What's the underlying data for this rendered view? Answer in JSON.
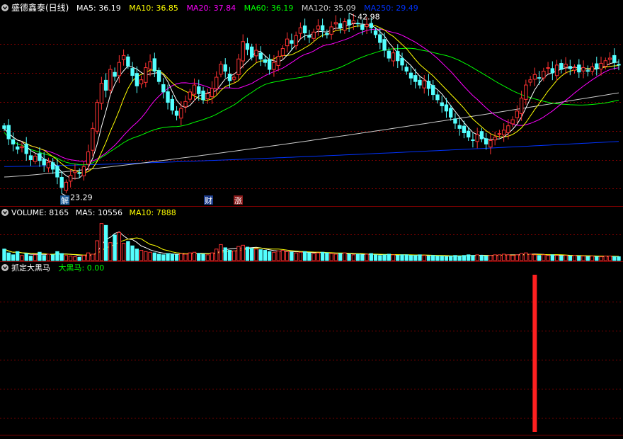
{
  "header": {
    "stock": "盛德鑫泰(日线)",
    "ma_items": [
      {
        "label": "MA5: 36.19",
        "color": "#ffffff"
      },
      {
        "label": "MA10: 36.85",
        "color": "#ffff00"
      },
      {
        "label": "MA20: 37.84",
        "color": "#ff00ff"
      },
      {
        "label": "MA60: 36.19",
        "color": "#00ff00"
      },
      {
        "label": "MA120: 35.09",
        "color": "#cccccc"
      },
      {
        "label": "MA250: 29.49",
        "color": "#0033ff"
      }
    ]
  },
  "volume_header": {
    "items": [
      {
        "label": "VOLUME: 8165",
        "color": "#ffffff"
      },
      {
        "label": "MA5: 10556",
        "color": "#ffffff"
      },
      {
        "label": "MA10: 7888",
        "color": "#ffff00"
      }
    ]
  },
  "indicator_header": {
    "name": "抓定大黑马",
    "value_label": "大黑马: 0.00",
    "value_color": "#00ff00"
  },
  "annotations": {
    "high": "42.98",
    "low": "23.29",
    "markers": [
      {
        "text": "解",
        "bg": "#1a5a9a"
      },
      {
        "text": "财",
        "bg": "#1a3a8a"
      },
      {
        "text": "涨",
        "bg": "#8a1a1a"
      }
    ]
  },
  "colors": {
    "up": "#ff3232",
    "down": "#54ffff",
    "grid": "#800000"
  },
  "chart_data": {
    "type": "candlestick",
    "price_range": [
      22.3,
      44.0
    ],
    "closes": [
      31.0,
      29.8,
      29.2,
      28.6,
      28.9,
      28.1,
      27.4,
      27.8,
      27.3,
      26.8,
      27.1,
      26.3,
      25.4,
      24.2,
      24.8,
      25.6,
      26.1,
      25.8,
      26.6,
      28.3,
      31.0,
      34.0,
      36.2,
      35.4,
      37.8,
      37.0,
      38.6,
      39.4,
      38.2,
      37.1,
      35.9,
      36.6,
      38.0,
      38.7,
      37.6,
      36.4,
      35.2,
      34.0,
      33.1,
      32.5,
      33.3,
      34.1,
      35.2,
      36.0,
      35.0,
      34.3,
      35.0,
      35.6,
      36.9,
      38.4,
      37.6,
      36.5,
      36.9,
      39.0,
      41.0,
      40.1,
      39.2,
      40.0,
      39.0,
      38.6,
      37.8,
      38.6,
      39.3,
      40.2,
      41.3,
      40.8,
      41.7,
      42.6,
      42.0,
      41.5,
      42.1,
      42.8,
      42.3,
      41.8,
      42.7,
      43.2,
      42.6,
      43.3,
      42.9,
      43.4,
      43.1,
      42.4,
      43.0,
      42.6,
      41.8,
      40.9,
      40.0,
      39.1,
      39.7,
      38.8,
      38.3,
      37.6,
      36.8,
      36.4,
      36.0,
      36.5,
      35.6,
      34.9,
      34.3,
      33.6,
      33.0,
      32.3,
      31.6,
      31.0,
      30.5,
      30.0,
      29.6,
      30.3,
      29.8,
      29.2,
      29.6,
      30.0,
      30.4,
      30.8,
      31.3,
      32.0,
      33.0,
      34.5,
      36.0,
      36.6,
      37.2,
      36.8,
      37.6,
      38.0,
      37.4,
      38.3,
      37.8,
      38.4,
      37.9,
      38.0,
      37.5,
      38.0,
      37.6,
      38.1,
      37.9,
      38.5,
      38.8,
      39.1,
      38.6,
      38.3
    ],
    "volumes": [
      18,
      12,
      9,
      14,
      8,
      11,
      7,
      9,
      13,
      8,
      10,
      9,
      14,
      11,
      8,
      7,
      6,
      5,
      8,
      12,
      10,
      31,
      58,
      55,
      28,
      40,
      44,
      27,
      30,
      23,
      18,
      16,
      14,
      13,
      12,
      10,
      9,
      11,
      10,
      9,
      11,
      10,
      12,
      13,
      11,
      10,
      9,
      12,
      18,
      25,
      20,
      16,
      15,
      22,
      24,
      21,
      19,
      18,
      17,
      16,
      14,
      13,
      15,
      16,
      14,
      13,
      12,
      13,
      14,
      12,
      11,
      12,
      13,
      12,
      11,
      10,
      11,
      12,
      10,
      9,
      10,
      9,
      10,
      11,
      9,
      8,
      9,
      10,
      9,
      8,
      9,
      9,
      8,
      8,
      9,
      8,
      7,
      8,
      7,
      7,
      6,
      7,
      8,
      7,
      8,
      9,
      8,
      9,
      8,
      7,
      8,
      9,
      9,
      10,
      9,
      8,
      9,
      11,
      12,
      10,
      9,
      8,
      9,
      8,
      9,
      8,
      7,
      8,
      7,
      8,
      7,
      7,
      6,
      7,
      6,
      6,
      7,
      7,
      6,
      6
    ],
    "volume_max": 62,
    "signal_index": 120
  }
}
